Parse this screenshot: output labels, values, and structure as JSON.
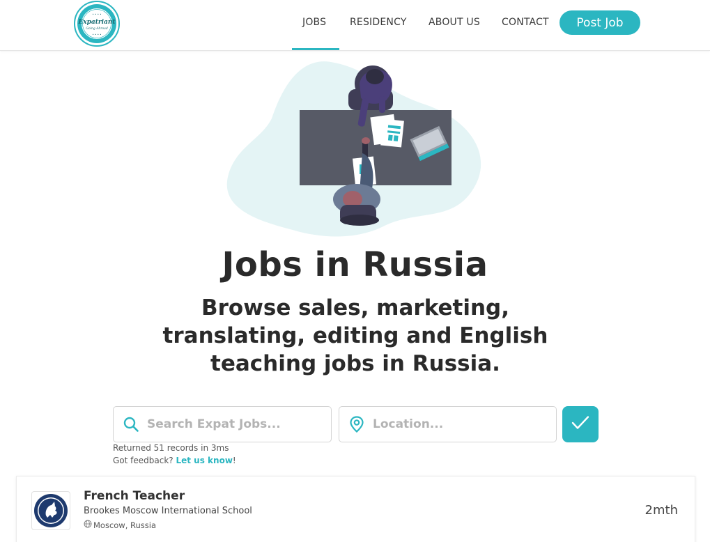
{
  "header": {
    "logo_title": "Expatriant",
    "logo_tagline": "Going Abroad",
    "nav": {
      "jobs": "JOBS",
      "residency": "RESIDENCY",
      "about": "ABOUT US",
      "contact": "CONTACT"
    },
    "post_job_label": "Post Job"
  },
  "hero": {
    "title": "Jobs in Russia",
    "subtitle": "Browse sales, marketing, translating, editing and English teaching jobs in Russia."
  },
  "search": {
    "query_placeholder": "Search Expat Jobs...",
    "query_value": "",
    "location_placeholder": "Location...",
    "location_value": ""
  },
  "results": {
    "summary": "Returned 51 records in 3ms",
    "feedback_prefix": "Got feedback?",
    "feedback_link": "Let us know",
    "feedback_suffix": "!"
  },
  "jobs": [
    {
      "title": "French Teacher",
      "company": "Brookes Moscow International School",
      "location": "Moscow, Russia",
      "age": "2mth"
    }
  ],
  "colors": {
    "accent": "#2bb6c1",
    "text": "#2a2a2a",
    "blob": "#e4f4f5",
    "desk": "#575a66"
  },
  "icons": {
    "search": "search-icon",
    "location": "map-pin-icon",
    "submit": "checkmark-icon",
    "globe": "globe-icon"
  }
}
